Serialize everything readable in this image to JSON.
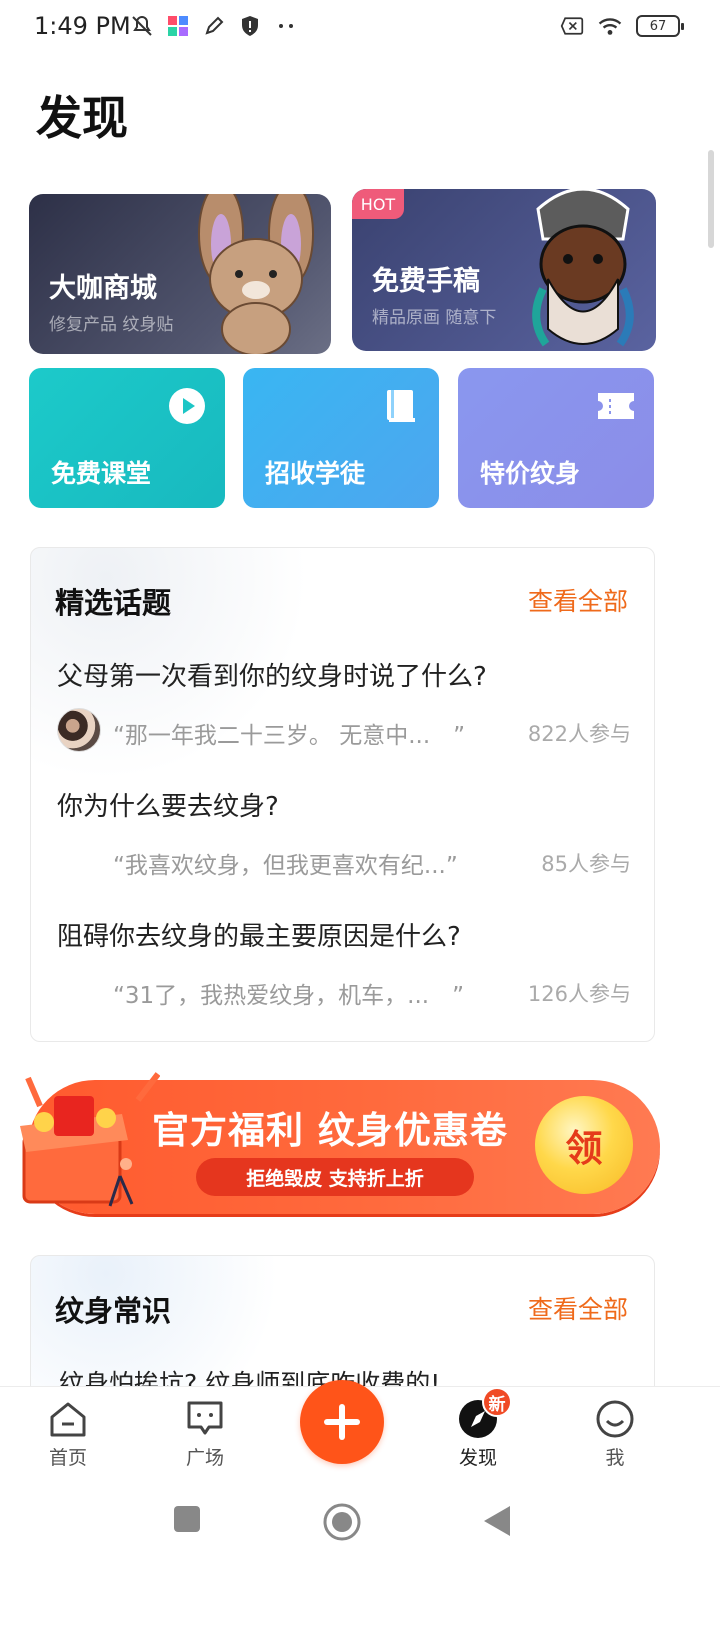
{
  "status_bar": {
    "time": "1:49 PM",
    "battery": "67",
    "icons_left": [
      "mute-icon",
      "app-icon",
      "pen-icon",
      "shield-icon",
      "more-dots-icon"
    ],
    "icons_right": [
      "sim-off-icon",
      "wifi-icon",
      "battery-icon"
    ]
  },
  "page": {
    "title": "发现"
  },
  "feature_cards": {
    "mall": {
      "title": "大咖商城",
      "subtitle": "修复产品 纹身贴"
    },
    "draft": {
      "badge": "HOT",
      "title": "免费手稿",
      "subtitle": "精品原画 随意下"
    },
    "free_class": {
      "title": "免费课堂",
      "icon": "play-icon"
    },
    "apprentice": {
      "title": "招收学徒",
      "icon": "book-icon"
    },
    "discount": {
      "title": "特价纹身",
      "icon": "ticket-icon"
    }
  },
  "topics": {
    "heading": "精选话题",
    "more": "查看全部",
    "items": [
      {
        "question": "父母第一次看到你的纹身时说了什么?",
        "quote": "“那一年我二十三岁。 无意中...　”",
        "count": "822人参与"
      },
      {
        "question": "你为什么要去纹身?",
        "quote": "“我喜欢纹身，但我更喜欢有纪...”",
        "count": "85人参与"
      },
      {
        "question": "阻碍你去纹身的最主要原因是什么?",
        "quote": "“31了，我热爱纹身，机车，...　”",
        "count": "126人参与"
      }
    ]
  },
  "banner": {
    "title": "官方福利 纹身优惠卷",
    "subtitle": "拒绝毁皮 支持折上折",
    "claim": "领"
  },
  "tips": {
    "heading": "纹身常识",
    "more": "查看全部",
    "first_item": "纹身怕挨坑? 纹身师到底咋收费的!"
  },
  "bottom_nav": {
    "home": "首页",
    "square": "广场",
    "discover": "发现",
    "discover_badge": "新",
    "me": "我"
  },
  "colors": {
    "accent": "#ff5419",
    "link": "#ef6a1b",
    "teal": "#1ccaca",
    "blue": "#39b6f2",
    "violet": "#8a97ef"
  }
}
